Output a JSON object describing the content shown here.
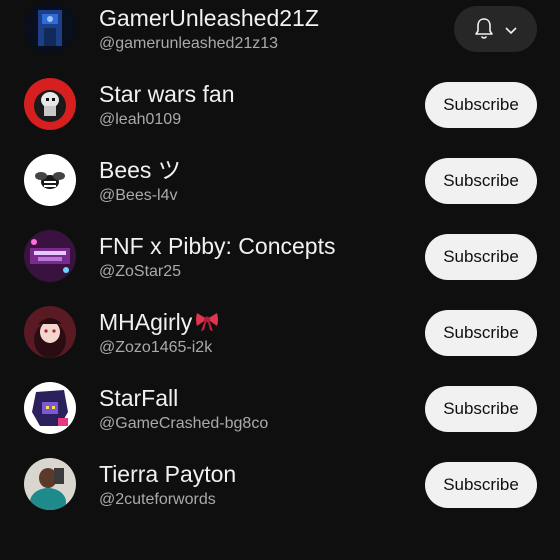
{
  "subscriptions": [
    {
      "name": "GamerUnleashed21Z",
      "handle": "@gamerunleashed21z13",
      "action": "bell"
    },
    {
      "name": "Star wars fan",
      "handle": "@leah0109",
      "action": "Subscribe"
    },
    {
      "name": "Bees ツ",
      "handle": "@Bees-l4v",
      "action": "Subscribe"
    },
    {
      "name": "FNF x Pibby: Concepts",
      "handle": "@ZoStar25",
      "action": "Subscribe"
    },
    {
      "name": "MHAgirly",
      "handle": "@Zozo1465-i2k",
      "action": "Subscribe"
    },
    {
      "name": "StarFall",
      "handle": "@GameCrashed-bg8co",
      "action": "Subscribe"
    },
    {
      "name": "Tierra Payton",
      "handle": "@2cuteforwords",
      "action": "Subscribe"
    }
  ],
  "icons": {
    "notification": "bell-icon",
    "dropdown": "chevron-down-icon",
    "name_emoji": "ribbon-icon"
  },
  "colors": {
    "background": "#0f0f0f",
    "primary_text": "#f1f1f1",
    "secondary_text": "#aaaaaa",
    "subscribe_bg": "#f1f1f1",
    "bell_button_bg": "#272727",
    "ribbon": "#e0344f"
  }
}
